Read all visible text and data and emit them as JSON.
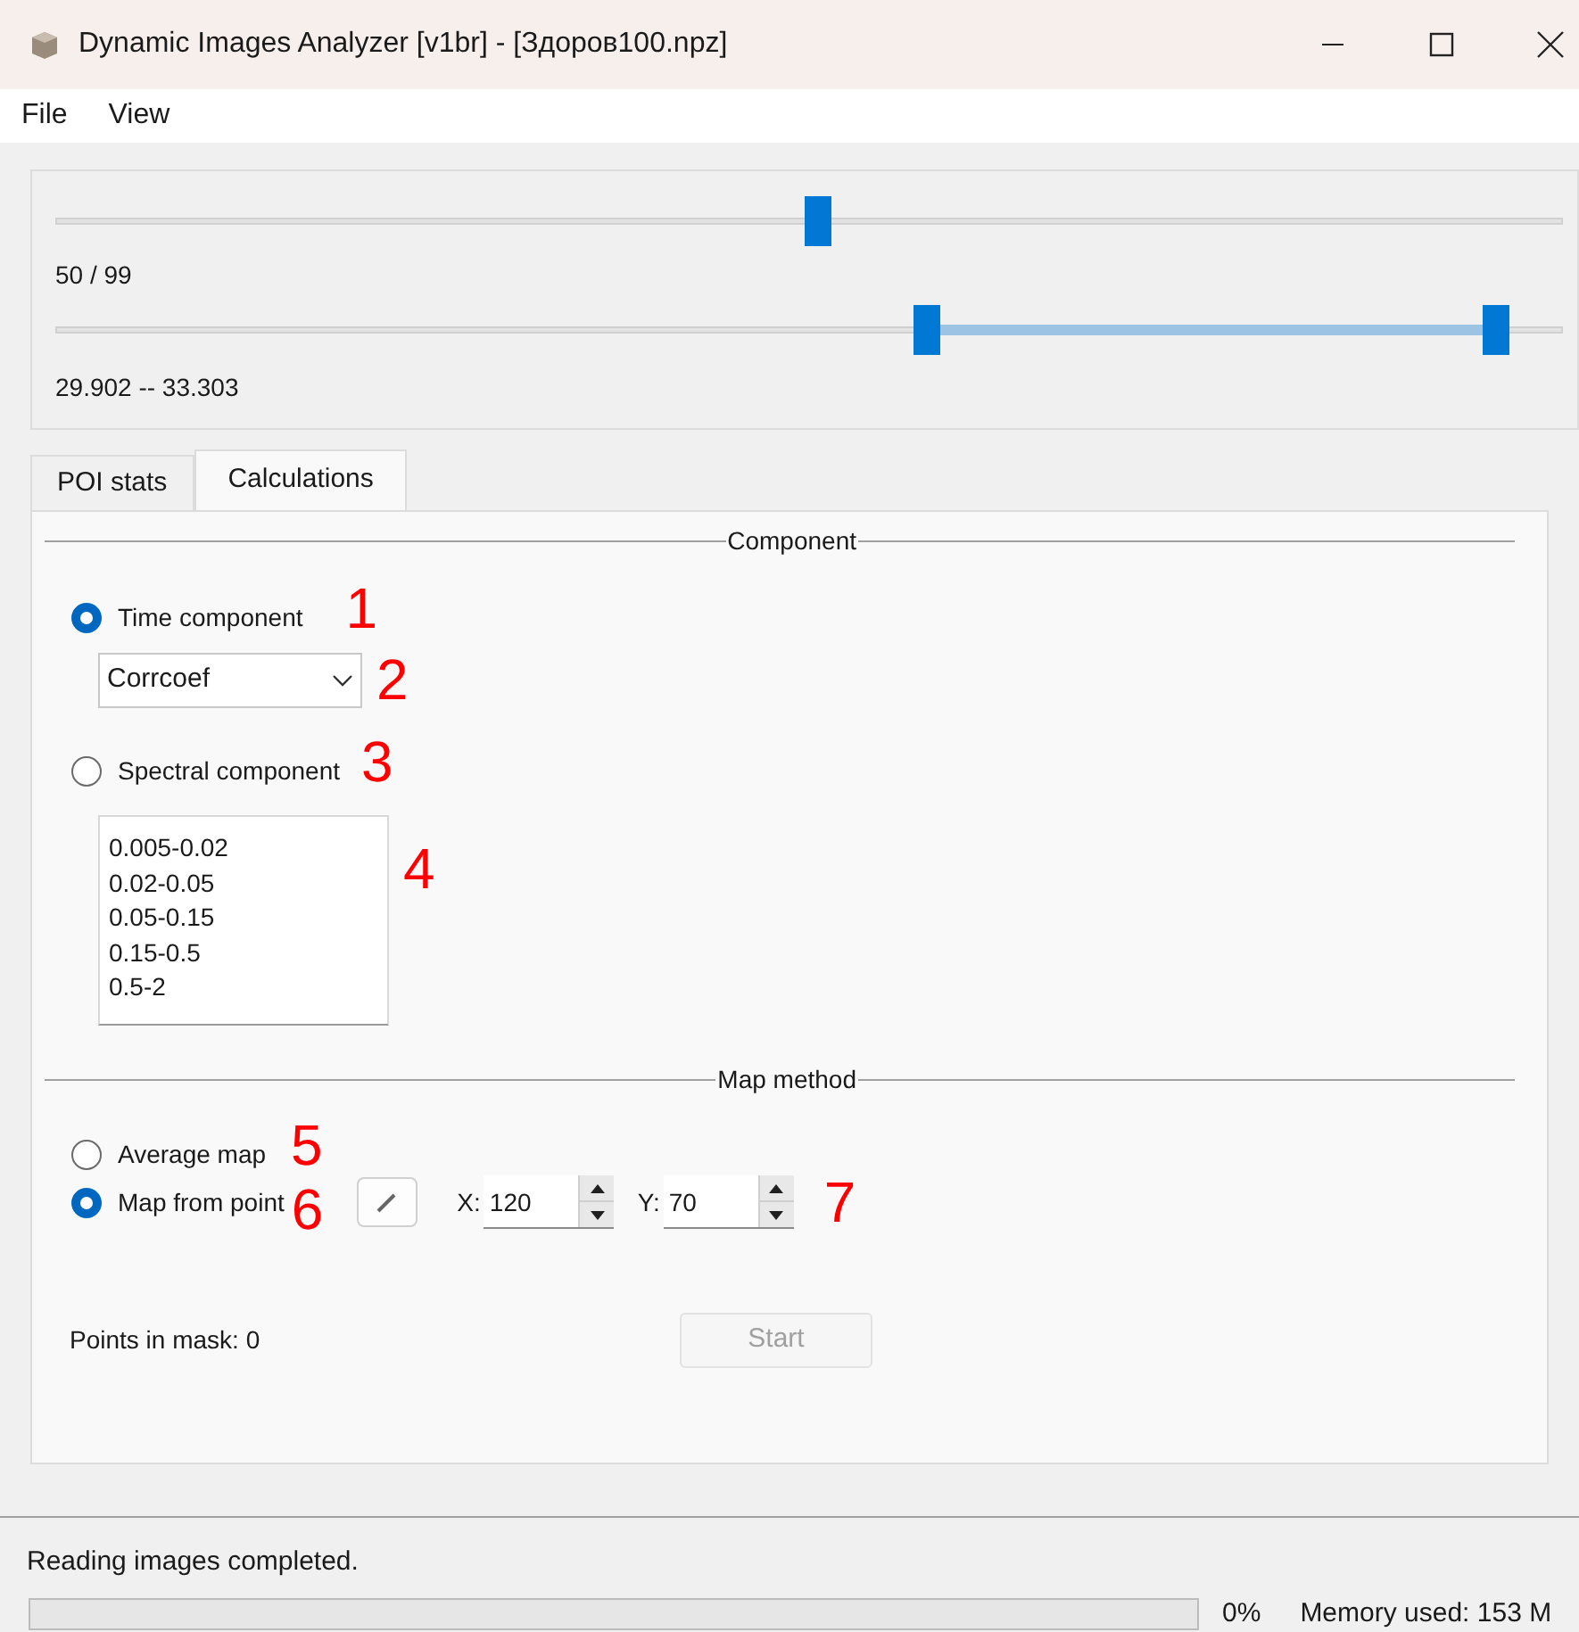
{
  "window": {
    "title": "Dynamic Images Analyzer [v1br] - [Здоров100.npz]"
  },
  "menu": [
    "File",
    "View"
  ],
  "frame_slider": {
    "level": 0.505,
    "reading": "50 / 99"
  },
  "range_slider": {
    "handles": [
      {
        "level": 0.578
      },
      {
        "level": 0.955
      }
    ],
    "reading": "29.902 -- 33.303"
  },
  "tabs": [
    {
      "label": "POI stats",
      "selected": false
    },
    {
      "label": "Calculations",
      "selected": true
    }
  ],
  "component_group": {
    "title": "Component",
    "time_radio": {
      "label": "Time component",
      "selected": true,
      "annotation": "1"
    },
    "method_combo": {
      "value": "Corrcoef",
      "annotation": "2"
    },
    "spectral_radio": {
      "label": "Spectral component",
      "selected": false,
      "annotation": "3"
    },
    "bands_list": {
      "items": [
        "0.005-0.02",
        "0.02-0.05",
        "0.05-0.15",
        "0.15-0.5",
        "0.5-2"
      ],
      "annotation": "4"
    }
  },
  "map_group": {
    "title": "Map method",
    "average_radio": {
      "label": "Average map",
      "selected": false,
      "annotation": "5"
    },
    "point_radio": {
      "label": "Map from point",
      "selected": true,
      "annotation": "6"
    },
    "x_spin": {
      "label": "X:",
      "value": "120"
    },
    "y_spin": {
      "label": "Y:",
      "value": "70"
    },
    "spin_annotation": "7"
  },
  "points_in_mask": "Points in mask: 0",
  "start_button": {
    "label": "Start",
    "disabled": true
  },
  "status_bar": {
    "message": "Reading images completed.",
    "progress": {
      "level": 0,
      "reading": "0%"
    },
    "memory": "Memory used: 153 M"
  }
}
